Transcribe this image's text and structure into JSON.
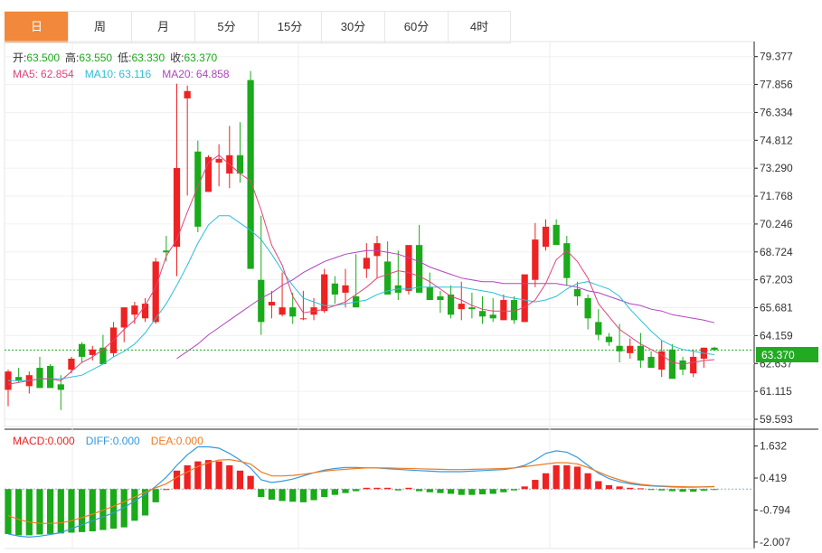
{
  "tabs": [
    {
      "label": "日",
      "active": true
    },
    {
      "label": "周",
      "active": false
    },
    {
      "label": "月",
      "active": false
    },
    {
      "label": "5分",
      "active": false
    },
    {
      "label": "15分",
      "active": false
    },
    {
      "label": "30分",
      "active": false
    },
    {
      "label": "60分",
      "active": false
    },
    {
      "label": "4时",
      "active": false
    }
  ],
  "ohlc_legend": {
    "open_label": "开:",
    "open": "63.500",
    "high_label": "高:",
    "high": "63.550",
    "low_label": "低:",
    "low": "63.330",
    "close_label": "收:",
    "close": "63.370"
  },
  "ma_legend": {
    "ma5_label": "MA5:",
    "ma5": "62.854",
    "ma10_label": "MA10:",
    "ma10": "63.116",
    "ma20_label": "MA20:",
    "ma20": "64.858"
  },
  "macd_legend": {
    "macd_label": "MACD:",
    "macd": "0.000",
    "diff_label": "DIFF:",
    "diff": "0.000",
    "dea_label": "DEA:",
    "dea": "0.000"
  },
  "current_price_label": "63.370",
  "colors": {
    "up": "#ee2222",
    "down": "#1aaa1a",
    "ma5": "#e0457b",
    "ma10": "#2bbfd9",
    "ma20": "#b044c0",
    "diff": "#3399e0",
    "dea": "#f07b22",
    "active_tab": "#f1883b",
    "price_tag": "#22aa22"
  },
  "chart_data": {
    "type": "candlestick",
    "price_axis_ticks": [
      "79.377",
      "77.856",
      "76.334",
      "74.812",
      "73.290",
      "71.768",
      "70.246",
      "68.724",
      "67.203",
      "65.681",
      "64.159",
      "62.637",
      "61.115",
      "59.593"
    ],
    "macd_axis_ticks": [
      "1.632",
      "0.419",
      "-0.794",
      "-2.007"
    ],
    "ylim": [
      59.2,
      80.2
    ],
    "macd_ylim": [
      -2.25,
      2.2
    ],
    "candles": [
      [
        61.2,
        62.3,
        60.3,
        62.2
      ],
      [
        61.9,
        62.4,
        61.6,
        61.7
      ],
      [
        61.4,
        62.2,
        61.0,
        62.0
      ],
      [
        62.4,
        63.0,
        61.4,
        61.3
      ],
      [
        62.5,
        62.6,
        61.4,
        61.3
      ],
      [
        61.5,
        62.0,
        60.1,
        61.2
      ],
      [
        62.3,
        63.0,
        62.1,
        62.9
      ],
      [
        63.7,
        63.8,
        62.7,
        63.0
      ],
      [
        63.1,
        63.6,
        62.8,
        63.4
      ],
      [
        63.5,
        64.2,
        62.9,
        62.6
      ],
      [
        63.2,
        64.9,
        63.0,
        64.6
      ],
      [
        64.6,
        65.1,
        63.8,
        65.7
      ],
      [
        65.3,
        66.0,
        64.8,
        65.8
      ],
      [
        65.1,
        66.2,
        64.9,
        65.9
      ],
      [
        64.9,
        68.4,
        64.8,
        68.2
      ],
      [
        68.8,
        69.6,
        68.2,
        68.7
      ],
      [
        69.0,
        77.9,
        67.4,
        73.3
      ],
      [
        77.1,
        77.8,
        71.8,
        77.5
      ],
      [
        74.2,
        74.8,
        69.8,
        70.1
      ],
      [
        72.0,
        74.0,
        72.0,
        73.9
      ],
      [
        73.6,
        74.6,
        72.3,
        73.8
      ],
      [
        73.0,
        75.6,
        72.2,
        74.0
      ],
      [
        74.0,
        75.8,
        72.5,
        73.0
      ],
      [
        78.1,
        78.6,
        69.4,
        67.8
      ],
      [
        67.2,
        70.7,
        64.2,
        64.9
      ],
      [
        65.8,
        66.6,
        65.1,
        66.0
      ],
      [
        65.3,
        67.6,
        65.2,
        65.7
      ],
      [
        65.7,
        66.5,
        64.8,
        65.2
      ],
      [
        65.1,
        66.6,
        65.0,
        65.1
      ],
      [
        65.3,
        66.2,
        65.0,
        65.7
      ],
      [
        65.5,
        67.8,
        65.4,
        67.5
      ],
      [
        67.0,
        67.4,
        65.9,
        66.4
      ],
      [
        66.5,
        67.8,
        65.7,
        66.9
      ],
      [
        66.3,
        68.6,
        65.8,
        65.7
      ],
      [
        67.8,
        69.2,
        67.3,
        68.4
      ],
      [
        68.5,
        69.6,
        67.3,
        69.2
      ],
      [
        68.2,
        69.3,
        66.6,
        66.4
      ],
      [
        66.9,
        68.8,
        66.1,
        66.5
      ],
      [
        66.6,
        68.5,
        66.4,
        69.1
      ],
      [
        69.1,
        70.2,
        66.8,
        66.5
      ],
      [
        66.8,
        67.6,
        66.2,
        66.1
      ],
      [
        66.3,
        66.6,
        65.4,
        66.1
      ],
      [
        66.4,
        66.9,
        65.1,
        65.3
      ],
      [
        65.6,
        67.1,
        65.0,
        65.9
      ],
      [
        65.7,
        66.5,
        65.1,
        65.6
      ],
      [
        65.5,
        66.3,
        64.8,
        65.2
      ],
      [
        65.3,
        66.2,
        64.9,
        65.1
      ],
      [
        65.0,
        66.4,
        65.0,
        66.1
      ],
      [
        66.1,
        66.3,
        64.8,
        65.0
      ],
      [
        64.9,
        67.2,
        64.9,
        67.5
      ],
      [
        67.2,
        70.3,
        66.8,
        69.4
      ],
      [
        69.0,
        70.5,
        68.8,
        70.1
      ],
      [
        70.2,
        70.5,
        69.4,
        69.1
      ],
      [
        69.2,
        69.6,
        66.9,
        67.3
      ],
      [
        66.7,
        67.1,
        65.8,
        66.3
      ],
      [
        66.2,
        66.4,
        64.5,
        65.1
      ],
      [
        64.9,
        65.6,
        63.9,
        64.2
      ],
      [
        64.1,
        64.3,
        63.6,
        63.8
      ],
      [
        63.6,
        64.8,
        62.7,
        63.3
      ],
      [
        63.2,
        64.0,
        62.9,
        63.6
      ],
      [
        63.6,
        64.3,
        62.4,
        62.8
      ],
      [
        63.0,
        63.3,
        62.4,
        62.4
      ],
      [
        62.3,
        63.9,
        61.9,
        63.3
      ],
      [
        63.4,
        63.7,
        61.9,
        61.8
      ],
      [
        62.8,
        63.0,
        62.0,
        62.3
      ],
      [
        62.1,
        63.4,
        61.9,
        63.0
      ],
      [
        62.9,
        63.5,
        62.4,
        63.5
      ],
      [
        63.5,
        63.55,
        63.33,
        63.37
      ]
    ],
    "ma5": [
      61.5,
      61.6,
      61.7,
      61.8,
      61.8,
      61.7,
      62.2,
      62.7,
      63.0,
      63.4,
      63.9,
      64.5,
      65.0,
      65.8,
      66.8,
      68.5,
      69.4,
      70.9,
      72.3,
      73.6,
      74.0,
      73.5,
      73.0,
      72.6,
      71.0,
      69.1,
      68.0,
      66.3,
      65.4,
      65.5,
      65.6,
      65.8,
      66.0,
      66.4,
      66.8,
      67.3,
      67.5,
      67.7,
      67.6,
      67.4,
      67.1,
      66.7,
      66.3,
      66.1,
      65.8,
      65.6,
      65.5,
      65.5,
      65.5,
      65.7,
      66.1,
      67.0,
      68.3,
      68.8,
      68.2,
      67.3,
      65.9,
      65.2,
      64.5,
      64.1,
      63.7,
      63.4,
      63.1,
      62.7,
      62.6,
      62.7,
      62.8,
      62.85
    ],
    "ma10": [
      61.7,
      61.7,
      61.7,
      61.8,
      61.8,
      61.8,
      61.9,
      62.0,
      62.3,
      62.6,
      63.0,
      63.3,
      63.7,
      64.3,
      65.1,
      65.9,
      66.9,
      68.0,
      69.2,
      70.2,
      70.7,
      70.7,
      70.3,
      69.9,
      69.4,
      68.6,
      67.7,
      66.9,
      66.2,
      66.0,
      65.8,
      65.8,
      65.9,
      66.0,
      66.1,
      66.4,
      66.6,
      66.7,
      66.7,
      66.8,
      66.8,
      66.8,
      66.8,
      66.8,
      66.7,
      66.6,
      66.5,
      66.3,
      66.2,
      66.1,
      66.0,
      66.1,
      66.3,
      66.7,
      67.0,
      67.1,
      66.9,
      66.7,
      66.3,
      65.6,
      65.0,
      64.4,
      63.9,
      63.6,
      63.4,
      63.3,
      63.2,
      63.12
    ],
    "ma20": [
      null,
      null,
      null,
      null,
      null,
      null,
      null,
      null,
      null,
      null,
      null,
      null,
      null,
      null,
      null,
      null,
      62.9,
      63.3,
      63.7,
      64.2,
      64.6,
      65.0,
      65.4,
      65.8,
      66.2,
      66.5,
      66.9,
      67.2,
      67.6,
      67.9,
      68.2,
      68.4,
      68.6,
      68.7,
      68.8,
      68.8,
      68.7,
      68.6,
      68.4,
      68.2,
      67.9,
      67.7,
      67.5,
      67.3,
      67.2,
      67.1,
      67.1,
      67.0,
      67.0,
      67.0,
      67.0,
      67.0,
      67.0,
      66.9,
      66.8,
      66.6,
      66.5,
      66.3,
      66.1,
      65.9,
      65.8,
      65.6,
      65.5,
      65.3,
      65.2,
      65.1,
      65.0,
      64.86
    ],
    "macd_bars": [
      -1.7,
      -1.75,
      -1.75,
      -1.72,
      -1.7,
      -1.68,
      -1.65,
      -1.63,
      -1.6,
      -1.55,
      -1.5,
      -1.45,
      -1.2,
      -1.0,
      -0.5,
      0.0,
      0.7,
      0.9,
      1.05,
      1.1,
      1.05,
      0.9,
      0.7,
      0.5,
      -0.3,
      -0.4,
      -0.45,
      -0.48,
      -0.5,
      -0.42,
      -0.3,
      -0.22,
      -0.15,
      -0.08,
      0.05,
      0.05,
      0.05,
      -0.05,
      0.05,
      -0.08,
      -0.12,
      -0.15,
      -0.18,
      -0.22,
      -0.22,
      -0.2,
      -0.18,
      -0.12,
      -0.05,
      0.1,
      0.35,
      0.6,
      0.9,
      0.9,
      0.85,
      0.6,
      0.3,
      0.15,
      0.1,
      0.05,
      0.03,
      -0.02,
      -0.05,
      -0.08,
      -0.1,
      -0.1,
      -0.06,
      -0.03
    ],
    "diff": [
      -1.7,
      -1.78,
      -1.82,
      -1.78,
      -1.72,
      -1.65,
      -1.5,
      -1.35,
      -1.2,
      -1.05,
      -0.9,
      -0.7,
      -0.45,
      -0.2,
      0.1,
      0.45,
      0.9,
      1.3,
      1.6,
      1.6,
      1.55,
      1.35,
      1.1,
      0.8,
      0.35,
      0.25,
      0.3,
      0.38,
      0.5,
      0.62,
      0.72,
      0.78,
      0.82,
      0.82,
      0.8,
      0.8,
      0.77,
      0.75,
      0.72,
      0.7,
      0.68,
      0.66,
      0.66,
      0.66,
      0.68,
      0.7,
      0.72,
      0.74,
      0.8,
      0.9,
      1.1,
      1.35,
      1.45,
      1.4,
      1.2,
      0.9,
      0.6,
      0.4,
      0.28,
      0.2,
      0.15,
      0.12,
      0.1,
      0.08,
      0.07,
      0.07,
      0.08,
      0.1
    ],
    "dea": [
      -1.0,
      -1.15,
      -1.25,
      -1.3,
      -1.3,
      -1.28,
      -1.2,
      -1.08,
      -0.95,
      -0.8,
      -0.65,
      -0.48,
      -0.3,
      -0.12,
      0.05,
      0.2,
      0.45,
      0.65,
      0.85,
      1.0,
      1.1,
      1.12,
      1.05,
      0.95,
      0.65,
      0.5,
      0.5,
      0.52,
      0.56,
      0.62,
      0.68,
      0.72,
      0.75,
      0.78,
      0.8,
      0.8,
      0.8,
      0.79,
      0.78,
      0.77,
      0.76,
      0.75,
      0.74,
      0.74,
      0.75,
      0.76,
      0.77,
      0.78,
      0.8,
      0.85,
      0.9,
      0.95,
      1.0,
      1.0,
      0.95,
      0.82,
      0.65,
      0.48,
      0.35,
      0.25,
      0.18,
      0.14,
      0.12,
      0.1,
      0.09,
      0.08,
      0.08,
      0.09
    ]
  }
}
